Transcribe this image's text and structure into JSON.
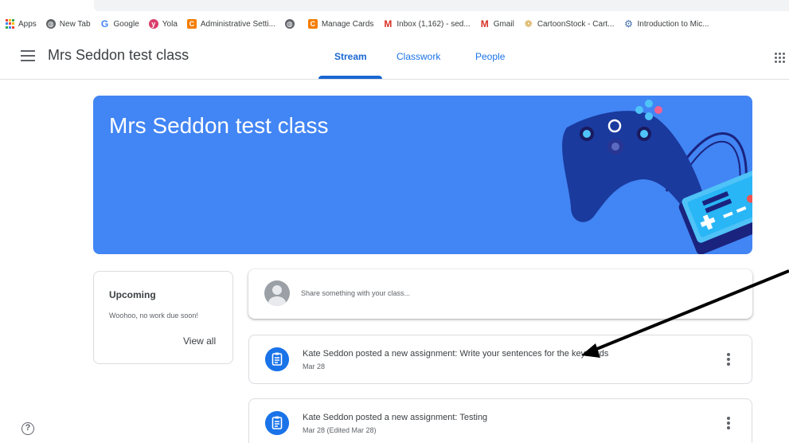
{
  "bookmarks": {
    "items": [
      {
        "label": "Apps",
        "icon": "apps-grid-icon"
      },
      {
        "label": "New Tab",
        "icon": "globe-icon"
      },
      {
        "label": "Google",
        "icon": "google-g-icon"
      },
      {
        "label": "Yola",
        "icon": "yola-icon"
      },
      {
        "label": "Administrative Setti...",
        "icon": "orange-favicon-icon"
      },
      {
        "label": "",
        "icon": "globe-icon"
      },
      {
        "label": "Manage Cards",
        "icon": "orange-favicon-icon"
      },
      {
        "label": "Inbox (1,162) - sed...",
        "icon": "gmail-icon"
      },
      {
        "label": "Gmail",
        "icon": "gmail-icon"
      },
      {
        "label": "CartoonStock - Cart...",
        "icon": "cartoonstock-icon"
      },
      {
        "label": "Introduction to Mic...",
        "icon": "gear-icon"
      }
    ]
  },
  "header": {
    "class_title": "Mrs Seddon test class",
    "tabs": [
      {
        "label": "Stream",
        "active": true
      },
      {
        "label": "Classwork",
        "active": false
      },
      {
        "label": "People",
        "active": false
      }
    ]
  },
  "banner": {
    "title": "Mrs Seddon test class",
    "color": "#4285f4"
  },
  "upcoming": {
    "title": "Upcoming",
    "message": "Woohoo, no work due soon!",
    "view_all": "View all"
  },
  "share": {
    "placeholder": "Share something with your class..."
  },
  "posts": [
    {
      "title": "Kate Seddon posted a new assignment: Write your sentences for the keywords",
      "date": "Mar 28"
    },
    {
      "title": "Kate Seddon posted a new assignment: Testing",
      "date": "Mar 28 (Edited Mar 28)"
    }
  ],
  "colors": {
    "accent": "#1967d2",
    "banner": "#4285f4",
    "post_icon": "#1a73e8"
  }
}
